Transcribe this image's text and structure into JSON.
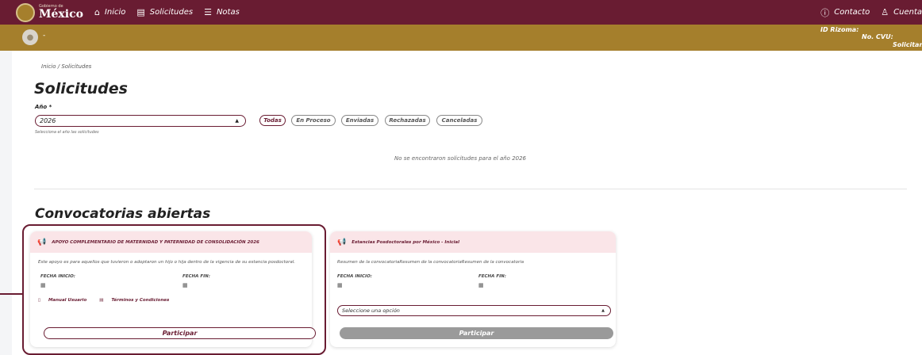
{
  "header": {
    "logo_small": "Gobierno de",
    "logo_big": "México",
    "nav": [
      {
        "label": "Inicio",
        "icon": "home-icon"
      },
      {
        "label": "Solicitudes",
        "icon": "document-icon"
      },
      {
        "label": "Notas",
        "icon": "list-icon"
      }
    ],
    "right_nav": [
      {
        "label": "Contacto",
        "icon": "help-circle-icon"
      },
      {
        "label": "Cuenta",
        "icon": "user-icon"
      }
    ]
  },
  "userbar": {
    "name": "-",
    "id_rizoma": "ID Rizoma:",
    "cvu": "No. CVU:",
    "solicitante": "Solicitante"
  },
  "breadcrumb": "Inicio / Solicitudes",
  "page_title": "Solicitudes",
  "filters": {
    "year_label": "Año *",
    "year_value": "2026",
    "year_help": "Selecciona el año las solicitudes",
    "statuses": [
      "Todas",
      "En Proceso",
      "Enviadas",
      "Rechazadas",
      "Canceladas"
    ],
    "active_status": "Todas"
  },
  "empty_message": "No se encontraron solicitudes para el año 2026",
  "convocatorias": {
    "title": "Convocatorias abiertas",
    "cards": [
      {
        "title": "APOYO COMPLEMENTARIO DE MATERNIDAD Y PATERNIDAD DE CONSOLIDACIÓN 2026",
        "description": "Este apoyo es para aquellos que tuvieron o adoptaron un hijo o hija dentro de la vigencia de su estancia posdoctoral.",
        "start_label": "FECHA INICIO:",
        "end_label": "FECHA FIN:",
        "manual_label": "Manual Usuario",
        "terms_label": "Términos y Condiciones",
        "button_label": "Participar"
      },
      {
        "title": "Estancias Posdoctorales por México - Inicial",
        "description": "Resumen de la convocatoriaResumen de la convocatoriaResumen de la convocatoria",
        "start_label": "FECHA INICIO:",
        "end_label": "FECHA FIN:",
        "select_placeholder": "Seleccione una opción",
        "button_label": "Participar"
      }
    ]
  },
  "colors": {
    "primary": "#691c32",
    "gold": "#a57f2c",
    "card_header": "#fae5e8",
    "disabled": "#9a9a9a"
  }
}
